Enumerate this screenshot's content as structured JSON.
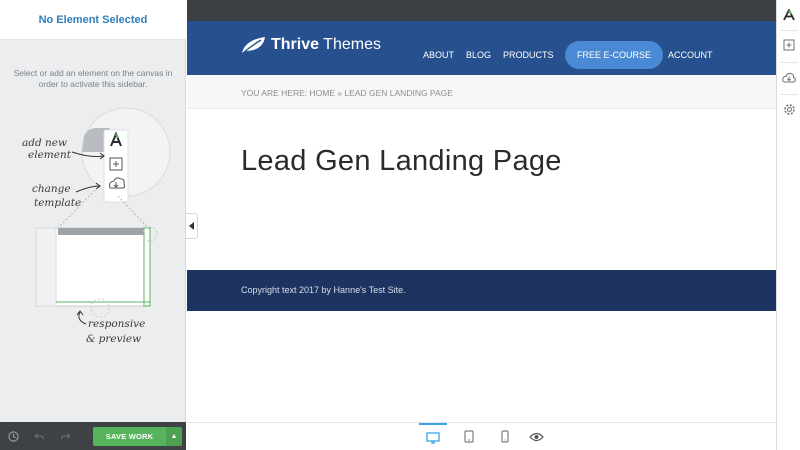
{
  "sidebar": {
    "header_title": "No Element Selected",
    "hint": "Select or add an element on the canvas in order to activate this sidebar.",
    "annotations": {
      "add": "add new element",
      "template": "change template",
      "responsive": "responsive & preview"
    },
    "footer": {
      "history_icon": "clock-icon",
      "undo_icon": "undo-icon",
      "redo_icon": "redo-icon",
      "save_label": "SAVE WORK",
      "save_options_icon": "chevron-up-icon"
    }
  },
  "site": {
    "logo": {
      "brand_bold": "Thrive",
      "brand_rest": " Themes",
      "icon": "leaf-icon"
    },
    "nav": [
      "ABOUT",
      "BLOG",
      "PRODUCTS"
    ],
    "cta": "FREE E-COURSE",
    "nav_last": "ACCOUNT",
    "breadcrumb": "YOU ARE HERE:  HOME » LEAD GEN LANDING PAGE",
    "page_title": "Lead Gen Landing Page",
    "copyright": "Copyright text 2017 by Hanne's Test Site."
  },
  "preview_bar": {
    "devices": [
      "desktop-icon",
      "tablet-icon",
      "mobile-icon"
    ],
    "active_device": "desktop",
    "preview_icon": "eye-icon"
  },
  "right_rail": [
    "thrive-architect-logo-icon",
    "add-element-icon",
    "cloud-template-icon",
    "settings-gear-icon"
  ],
  "colors": {
    "brand_blue": "#27508f",
    "cta_blue": "#4a8ad4",
    "footer_navy": "#1d3461",
    "save_green": "#58b45c",
    "sidebar_title": "#2d7fb8"
  }
}
